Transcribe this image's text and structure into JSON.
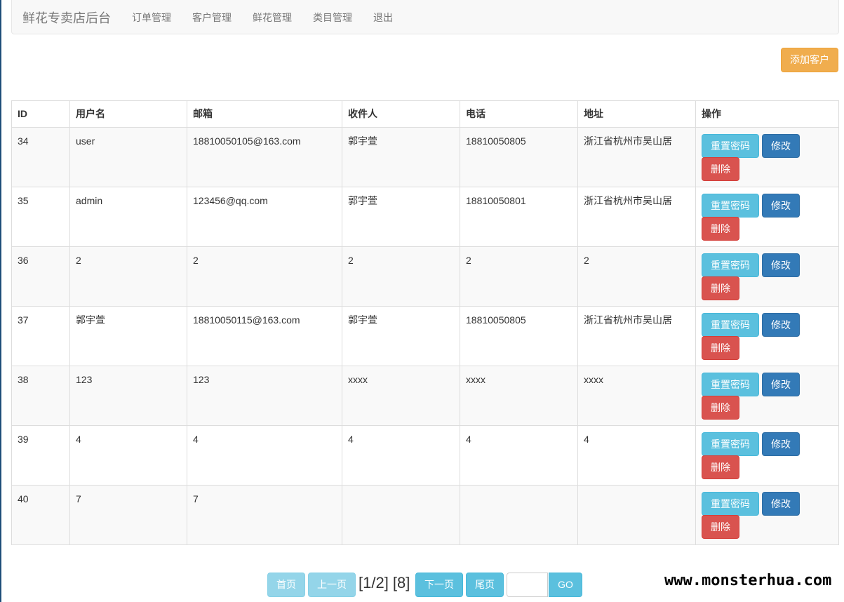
{
  "navbar": {
    "brand": "鲜花专卖店后台",
    "links": [
      "订单管理",
      "客户管理",
      "鲜花管理",
      "类目管理",
      "退出"
    ]
  },
  "toolbar": {
    "add_label": "添加客户"
  },
  "table": {
    "headers": [
      "ID",
      "用户名",
      "邮箱",
      "收件人",
      "电话",
      "地址",
      "操作"
    ],
    "rows": [
      [
        "34",
        "user",
        "18810050105@163.com",
        "郭宇萱",
        "18810050805",
        "浙江省杭州市吴山居"
      ],
      [
        "35",
        "admin",
        "123456@qq.com",
        "郭宇萱",
        "18810050801",
        "浙江省杭州市吴山居"
      ],
      [
        "36",
        "2",
        "2",
        "2",
        "2",
        "2"
      ],
      [
        "37",
        "郭宇萱",
        "18810050115@163.com",
        "郭宇萱",
        "18810050805",
        "浙江省杭州市吴山居"
      ],
      [
        "38",
        "123",
        "123",
        "xxxx",
        "xxxx",
        "xxxx"
      ],
      [
        "39",
        "4",
        "4",
        "4",
        "4",
        "4"
      ],
      [
        "40",
        "7",
        "7",
        "",
        "",
        ""
      ]
    ],
    "actions": {
      "reset": "重置密码",
      "edit": "修改",
      "delete": "删除"
    }
  },
  "pager": {
    "first": "首页",
    "prev": "上一页",
    "info": "[1/2] [8]",
    "next": "下一页",
    "last": "尾页",
    "input_value": "",
    "go": "GO"
  },
  "watermark": "www.monsterhua.com",
  "colors": {
    "warning": "#f0ad4e",
    "info": "#5bc0de",
    "primary": "#337ab7",
    "danger": "#d9534f"
  }
}
